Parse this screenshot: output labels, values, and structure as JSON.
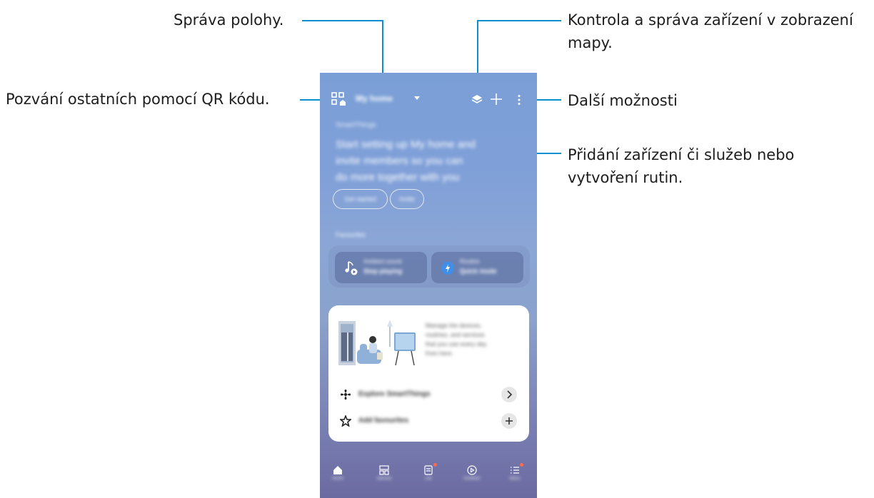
{
  "annotations": {
    "location": "Správa polohy.",
    "qr_invite": "Pozvání ostatních pomocí QR kódu.",
    "map_view_line1": "Kontrola a správa zařízení v zobrazení",
    "map_view_line2": "mapy.",
    "more_options": "Další možnosti",
    "add_line1": "Přidání zařízení či služeb nebo",
    "add_line2": "vytvoření rutin."
  },
  "app": {
    "location_name": "My home",
    "welcome": {
      "title": "SmartThings",
      "lines": [
        "Start setting up My home and",
        "invite members so you can",
        "do more together with you"
      ],
      "buttons": [
        "Get started",
        "Invite"
      ]
    },
    "favorites": {
      "title": "Favourites",
      "tiles": [
        {
          "line1": "Ambient sound",
          "line2": "Stop playing",
          "icon": "music-note-icon"
        },
        {
          "line1": "Routine",
          "line2": "Quick mode",
          "icon": "routine-icon"
        }
      ]
    },
    "promo": {
      "text_lines": [
        "Manage the devices,",
        "routines, and services",
        "that you use every day",
        "from here."
      ],
      "rows": [
        {
          "label": "Explore SmartThings",
          "icon": "fan-icon",
          "action_icon": "chevron-right-icon"
        },
        {
          "label": "Add favourites",
          "icon": "star-icon",
          "action_icon": "plus-icon"
        }
      ]
    },
    "nav": [
      {
        "label": "Home",
        "icon": "home-icon"
      },
      {
        "label": "Devices",
        "icon": "devices-icon"
      },
      {
        "label": "Life",
        "icon": "life-icon"
      },
      {
        "label": "Routines",
        "icon": "routines-icon"
      },
      {
        "label": "Menu",
        "icon": "menu-icon"
      }
    ]
  },
  "colors": {
    "leader_line": "#0a8fd0",
    "badge": "#ff6b4a"
  }
}
